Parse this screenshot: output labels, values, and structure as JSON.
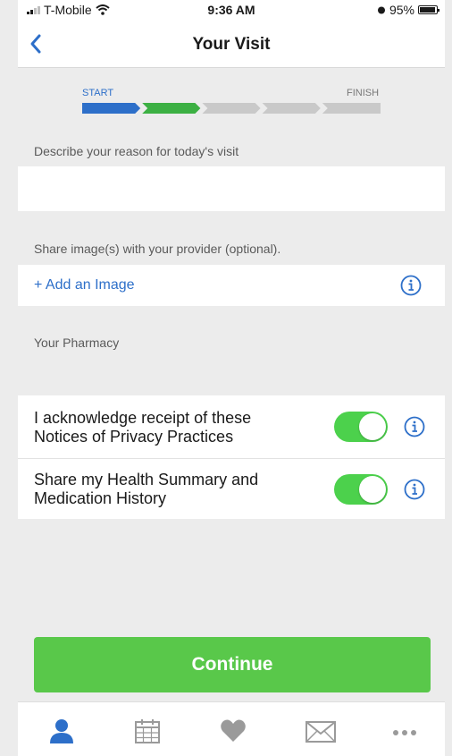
{
  "status_bar": {
    "carrier": "T-Mobile",
    "time": "9:36 AM",
    "battery": "95%",
    "icons": [
      "signal-icon",
      "wifi-icon",
      "alarm-icon",
      "battery-icon"
    ]
  },
  "nav": {
    "title": "Your Visit",
    "back_icon": "chevron-left-icon"
  },
  "progress": {
    "start_label": "START",
    "finish_label": "FINISH",
    "steps_total": 5,
    "step_states": [
      "complete",
      "current",
      "pending",
      "pending",
      "pending"
    ]
  },
  "form": {
    "reason_label": "Describe your reason for today's visit",
    "reason_value": "",
    "share_label": "Share image(s) with your provider (optional).",
    "add_image_label": "+ Add an Image",
    "pharmacy_label": "Your Pharmacy"
  },
  "toggles": [
    {
      "label_line1": "I acknowledge receipt of these",
      "label_line2": "Notices of Privacy Practices",
      "on": true
    },
    {
      "label_line1": "Share my Health Summary and",
      "label_line2": "Medication History",
      "on": true
    }
  ],
  "continue_label": "Continue",
  "tab_bar": {
    "tabs": [
      {
        "icon": "person-icon",
        "active": true
      },
      {
        "icon": "calendar-icon",
        "active": false
      },
      {
        "icon": "heart-icon",
        "active": false
      },
      {
        "icon": "envelope-icon",
        "active": false
      },
      {
        "icon": "more-icon",
        "active": false
      }
    ]
  },
  "colors": {
    "accent_blue": "#2d6fc9",
    "progress_green": "#3cb043",
    "toggle_green": "#4cd14c",
    "button_green": "#59c84a",
    "background_gray": "#ececec"
  }
}
